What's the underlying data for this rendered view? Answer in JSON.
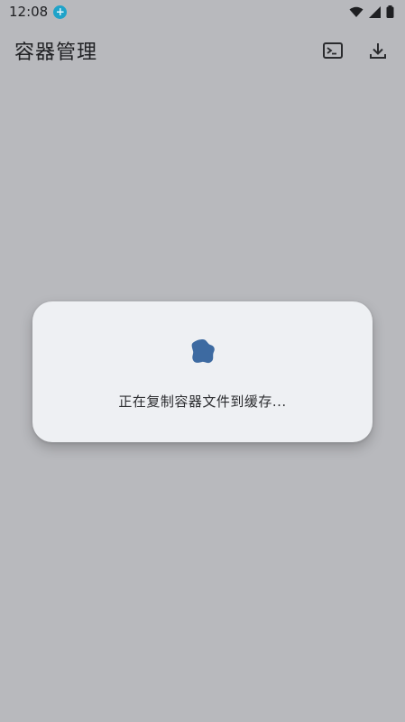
{
  "status_bar": {
    "time": "12:08",
    "notification_icon": "plus-badge-icon"
  },
  "app_bar": {
    "title": "容器管理",
    "actions": [
      {
        "icon": "terminal-icon"
      },
      {
        "icon": "download-icon"
      }
    ]
  },
  "dialog": {
    "message": "正在复制容器文件到缓存...",
    "spinner_color": "#3d6aa1"
  },
  "colors": {
    "scrim": "#b8b9bd",
    "dialog_bg": "#eef0f3",
    "accent": "#3d6aa1"
  }
}
